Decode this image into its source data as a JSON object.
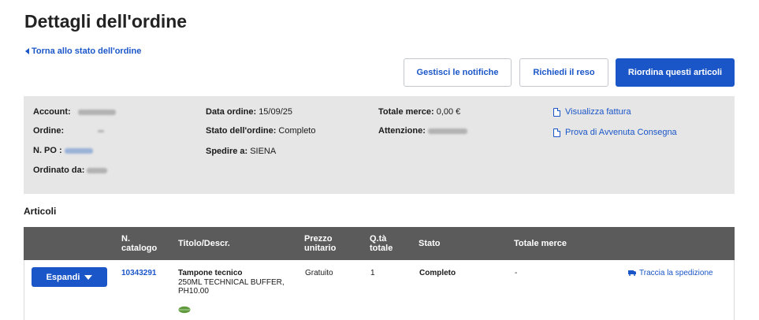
{
  "page": {
    "title": "Dettagli dell'ordine",
    "back_link": "Torna allo stato dell'ordine"
  },
  "actions": {
    "notifications": "Gestisci le notifiche",
    "return": "Richiedi il reso",
    "reorder": "Riordina questi articoli"
  },
  "order_info": {
    "account_label": "Account:",
    "order_label": "Ordine:",
    "po_label": "N. PO :",
    "ordered_by_label": "Ordinato da:",
    "order_date_label": "Data ordine:",
    "order_date": "15/09/25",
    "status_label": "Stato dell'ordine:",
    "status": "Completo",
    "ship_to_label": "Spedire a:",
    "ship_to": "SIENA",
    "total_label": "Totale merce:",
    "total": "0,00 €",
    "attention_label": "Attenzione:",
    "invoice_link": "Visualizza fattura",
    "delivery_proof_link": "Prova di Avvenuta Consegna"
  },
  "items": {
    "section_title": "Articoli",
    "columns": {
      "catalog": "N. catalogo",
      "title": "Titolo/Descr.",
      "unit_price": "Prezzo unitario",
      "qty": "Q.tà totale",
      "status": "Stato",
      "total": "Totale merce"
    },
    "rows": [
      {
        "expand_label": "Espandi",
        "catalog_no": "10343291",
        "title": "Tampone tecnico",
        "desc_line1": "250ML TECHNICAL BUFFER,",
        "desc_line2": "PH10.00",
        "unit_price": "Gratuito",
        "qty": "1",
        "status": "Completo",
        "total": "-",
        "track_label": "Traccia la spedizione",
        "eco_icon": "leaf-icon"
      }
    ]
  },
  "colors": {
    "accent": "#1a56c8",
    "panel": "#e6e6e6",
    "table_header": "#5b5b5b"
  }
}
